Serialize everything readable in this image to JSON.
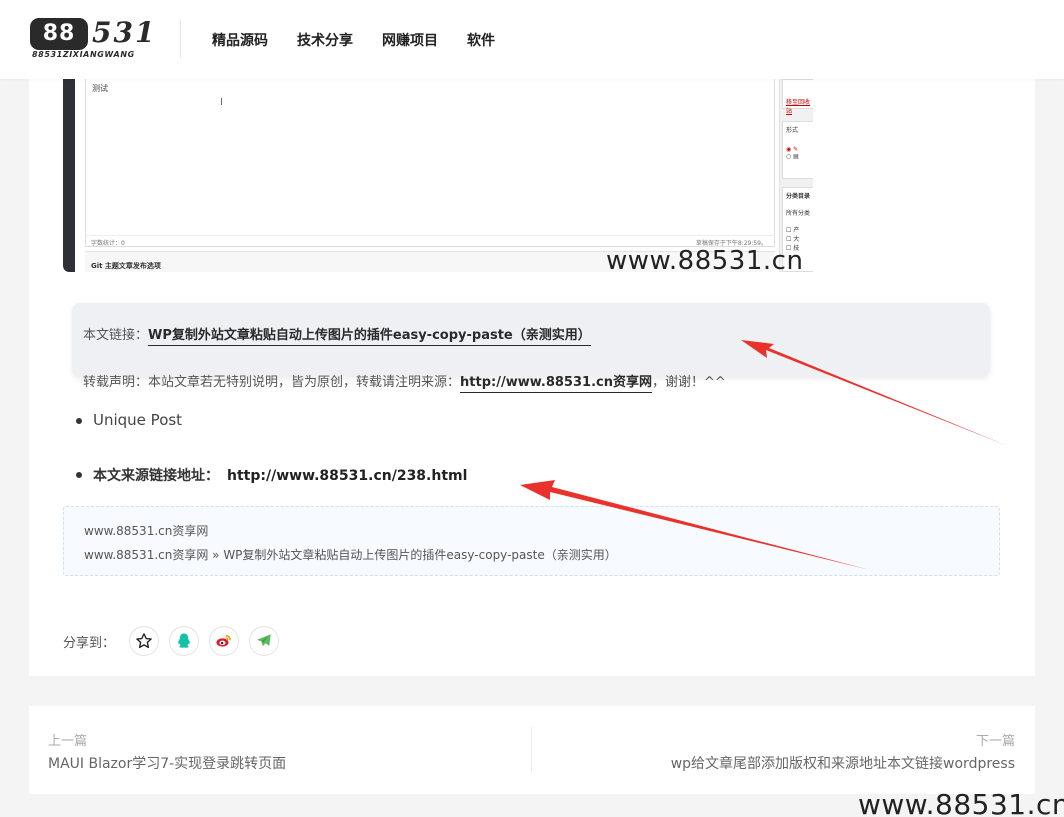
{
  "header": {
    "logo_main": "88",
    "logo_script": "531",
    "logo_sub": "88531ZIXIANGWANG",
    "nav": [
      "精品源码",
      "技术分享",
      "网赚项目",
      "软件"
    ]
  },
  "screenshot": {
    "editor_text": "测试",
    "word_count": "字数统计：0",
    "draft_saved": "草稿保存于下午8:29:59。",
    "panel_title": "Git 主题文章发布选项",
    "side_format": "形式",
    "side_category": "分类目录",
    "side_all": "所有分类",
    "side_red": "移至回收站",
    "watermark": "www.88531.cn"
  },
  "copyright": {
    "link_label": "本文链接：",
    "link_text": "WP复制外站文章粘贴自动上传图片的插件easy-copy-paste（亲测实用）",
    "statement_prefix": "转载声明：本站文章若无特别说明，皆为原创，转载请注明来源：",
    "statement_link": "http://www.88531.cn资享网",
    "statement_suffix": "，谢谢！^^"
  },
  "list": {
    "item1": "Unique Post",
    "item2_label": "本文来源链接地址：",
    "item2_link": "http://www.88531.cn/238.html"
  },
  "source": {
    "line1": "www.88531.cn资享网",
    "line2": "www.88531.cn资享网 » WP复制外站文章粘贴自动上传图片的插件easy-copy-paste（亲测实用）"
  },
  "share": {
    "label": "分享到：",
    "icons": [
      "star-icon",
      "qq-icon",
      "weibo-icon",
      "telegram-icon"
    ],
    "colors": {
      "qq": "#13c2a3",
      "weibo": "#e6162d",
      "telegram": "#5aba5e"
    }
  },
  "pager": {
    "prev_label": "上一篇",
    "prev_title": "MAUI Blazor学习7-实现登录跳转页面",
    "next_label": "下一篇",
    "next_title": "wp给文章尾部添加版权和来源地址本文链接wordpress"
  },
  "watermark": "www.88531.cn",
  "colors": {
    "arrow": "#e8322b",
    "copy_box": "#eef0f3"
  }
}
